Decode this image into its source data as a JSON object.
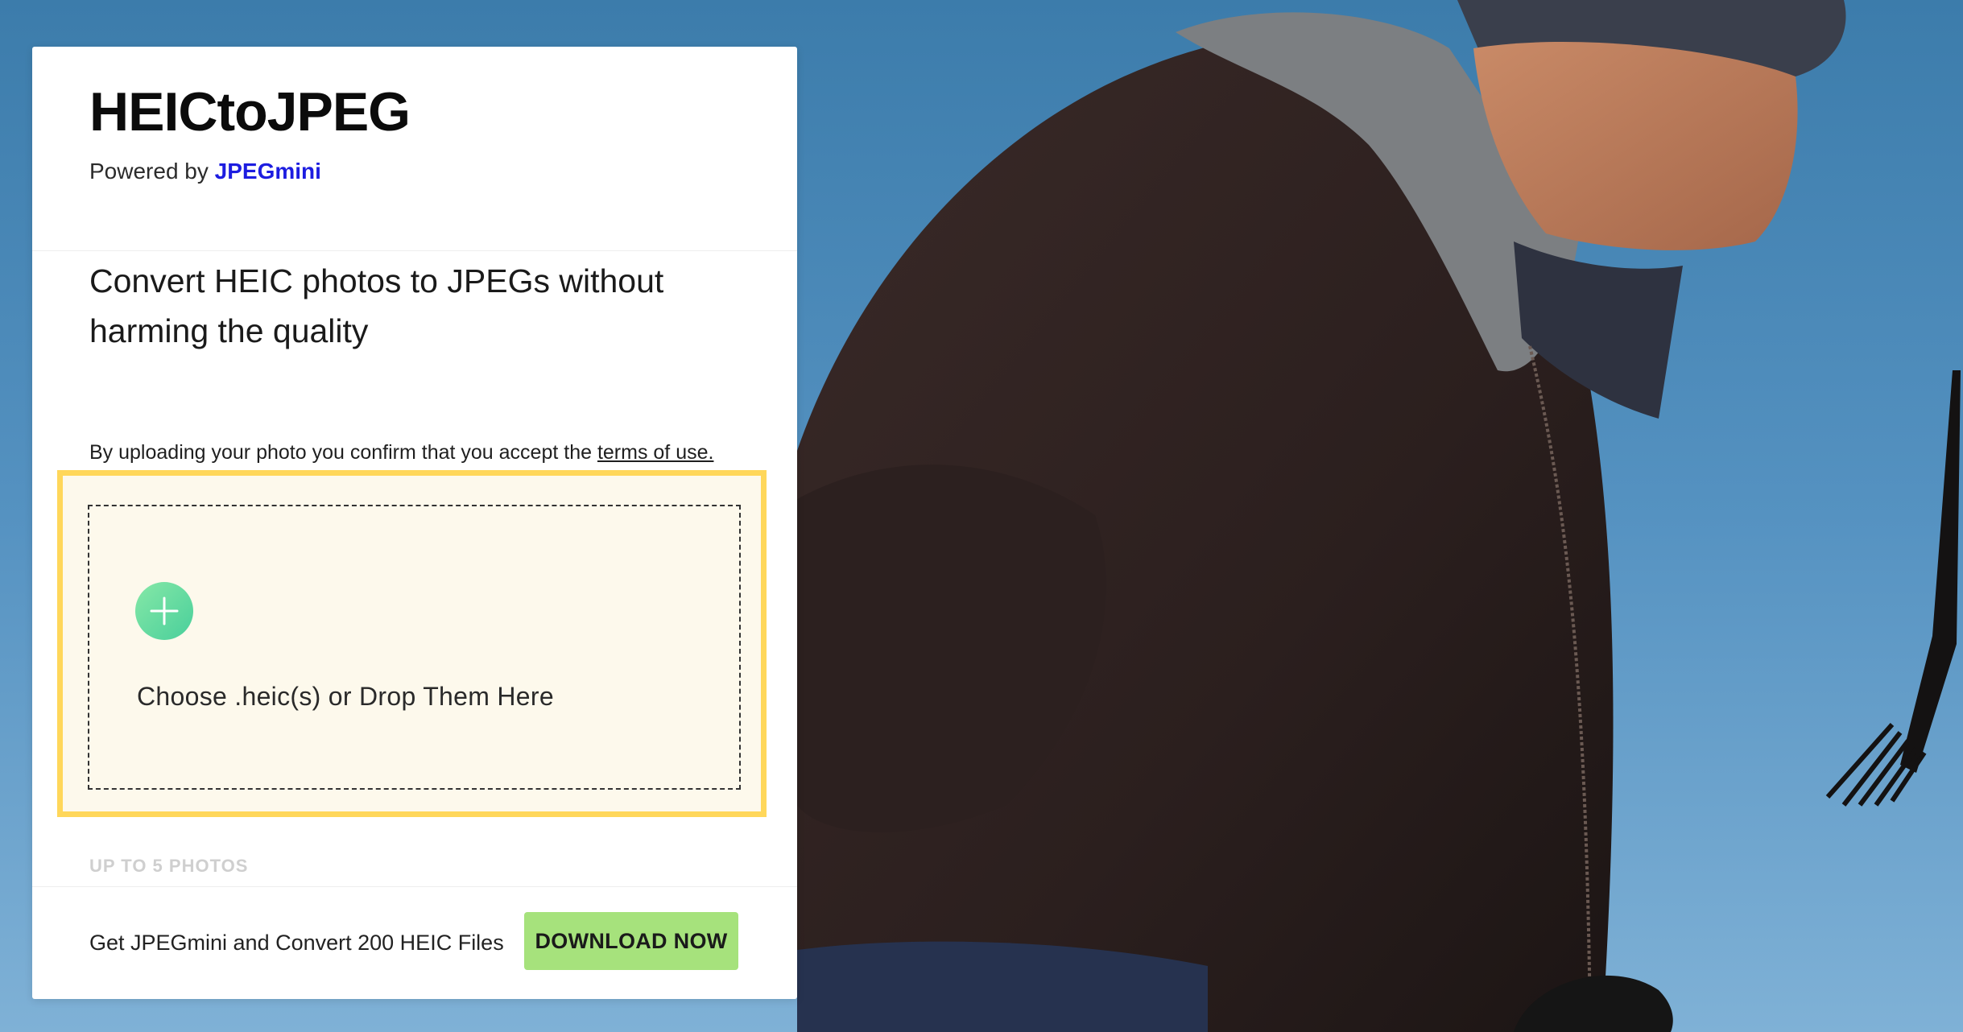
{
  "app": {
    "title": "HEICtoJPEG",
    "powered_prefix": "Powered by ",
    "powered_brand": "JPEGmini"
  },
  "main": {
    "tagline": "Convert HEIC photos to JPEGs without harming the quality",
    "terms_prefix": "By uploading your photo you confirm that you accept the ",
    "terms_link": "terms of use.",
    "upload": {
      "label": "Choose .heic(s) or Drop Them Here",
      "icon": "plus-icon",
      "limit": "UP TO 5 PHOTOS"
    }
  },
  "footer": {
    "promo_text": "Get JPEGmini and Convert 200 HEIC Files",
    "download_label": "DOWNLOAD NOW"
  },
  "colors": {
    "brand_link": "#1d1de0",
    "highlight": "#ffd75a",
    "upload_bg": "#fdf9ec",
    "plus_gradient_start": "#86e8a7",
    "plus_gradient_end": "#49cf9b",
    "download_button": "#a6e27c"
  }
}
